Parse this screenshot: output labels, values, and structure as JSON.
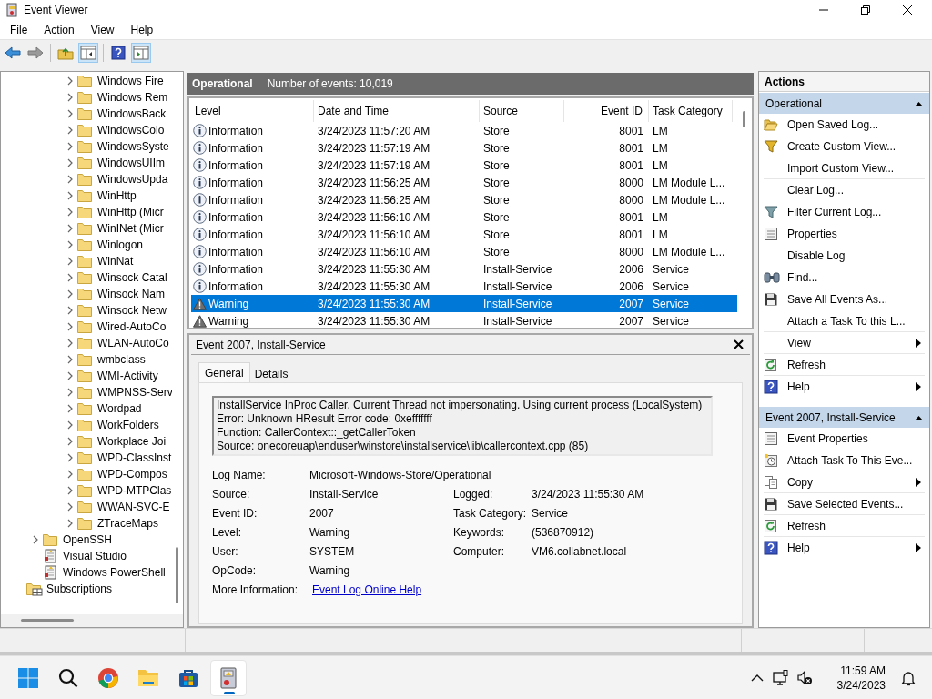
{
  "window": {
    "title": "Event Viewer"
  },
  "menu": [
    "File",
    "Action",
    "View",
    "Help"
  ],
  "toolbar": [
    {
      "kind": "back",
      "pressed": false
    },
    {
      "kind": "forward",
      "pressed": false
    },
    {
      "kind": "separator"
    },
    {
      "kind": "up",
      "pressed": false
    },
    {
      "kind": "tree-pane",
      "pressed": true
    },
    {
      "kind": "separator"
    },
    {
      "kind": "help",
      "pressed": false
    },
    {
      "kind": "action-pane",
      "pressed": true
    }
  ],
  "tree": [
    {
      "children": [
        {
          "children": [
            {
              "label": "Windows Fire",
              "kind": "folder",
              "expanded": false
            },
            {
              "label": "Windows Rem",
              "kind": "folder",
              "expanded": false
            },
            {
              "label": "WindowsBack",
              "kind": "folder",
              "expanded": false
            },
            {
              "label": "WindowsColo",
              "kind": "folder",
              "expanded": false
            },
            {
              "label": "WindowsSyste",
              "kind": "folder",
              "expanded": false
            },
            {
              "label": "WindowsUIIm",
              "kind": "folder",
              "expanded": false
            },
            {
              "label": "WindowsUpda",
              "kind": "folder",
              "expanded": false
            },
            {
              "label": "WinHttp",
              "kind": "folder",
              "expanded": false
            },
            {
              "label": "WinHttp (Micr",
              "kind": "folder",
              "expanded": false
            },
            {
              "label": "WinINet (Micr",
              "kind": "folder",
              "expanded": false
            },
            {
              "label": "Winlogon",
              "kind": "folder",
              "expanded": false
            },
            {
              "label": "WinNat",
              "kind": "folder",
              "expanded": false
            },
            {
              "label": "Winsock Catal",
              "kind": "folder",
              "expanded": false
            },
            {
              "label": "Winsock Nam",
              "kind": "folder",
              "expanded": false
            },
            {
              "label": "Winsock Netw",
              "kind": "folder",
              "expanded": false
            },
            {
              "label": "Wired-AutoCo",
              "kind": "folder",
              "expanded": false
            },
            {
              "label": "WLAN-AutoCo",
              "kind": "folder",
              "expanded": false
            },
            {
              "label": "wmbclass",
              "kind": "folder",
              "expanded": false
            },
            {
              "label": "WMI-Activity",
              "kind": "folder",
              "expanded": false
            },
            {
              "label": "WMPNSS-Serv",
              "kind": "folder",
              "expanded": false
            },
            {
              "label": "Wordpad",
              "kind": "folder",
              "expanded": false
            },
            {
              "label": "WorkFolders",
              "kind": "folder",
              "expanded": false
            },
            {
              "label": "Workplace Joi",
              "kind": "folder",
              "expanded": false
            },
            {
              "label": "WPD-ClassInst",
              "kind": "folder",
              "expanded": false
            },
            {
              "label": "WPD-Compos",
              "kind": "folder",
              "expanded": false
            },
            {
              "label": "WPD-MTPClas",
              "kind": "folder",
              "expanded": false
            },
            {
              "label": "WWAN-SVC-E",
              "kind": "folder",
              "expanded": false
            },
            {
              "label": "ZTraceMaps",
              "kind": "folder",
              "expanded": false
            }
          ]
        },
        {
          "label": "OpenSSH",
          "kind": "folder",
          "expanded": false
        },
        {
          "label": "Visual Studio",
          "kind": "log"
        },
        {
          "label": "Windows PowerShell",
          "kind": "log"
        }
      ]
    },
    {
      "label": "Subscriptions",
      "kind": "subscriptions"
    }
  ],
  "log_header": {
    "title": "Operational",
    "count": "Number of events: 10,019"
  },
  "events": {
    "columns": [
      "Level",
      "Date and Time",
      "Source",
      "Event ID",
      "Task Category"
    ],
    "rows": [
      {
        "kind": "information",
        "level": "Information",
        "date": "3/24/2023 11:57:20 AM",
        "source": "Store",
        "event_id": "8001",
        "task_category": "LM",
        "selected": false
      },
      {
        "kind": "information",
        "level": "Information",
        "date": "3/24/2023 11:57:19 AM",
        "source": "Store",
        "event_id": "8001",
        "task_category": "LM",
        "selected": false
      },
      {
        "kind": "information",
        "level": "Information",
        "date": "3/24/2023 11:57:19 AM",
        "source": "Store",
        "event_id": "8001",
        "task_category": "LM",
        "selected": false
      },
      {
        "kind": "information",
        "level": "Information",
        "date": "3/24/2023 11:56:25 AM",
        "source": "Store",
        "event_id": "8000",
        "task_category": "LM Module L...",
        "selected": false
      },
      {
        "kind": "information",
        "level": "Information",
        "date": "3/24/2023 11:56:25 AM",
        "source": "Store",
        "event_id": "8000",
        "task_category": "LM Module L...",
        "selected": false
      },
      {
        "kind": "information",
        "level": "Information",
        "date": "3/24/2023 11:56:10 AM",
        "source": "Store",
        "event_id": "8001",
        "task_category": "LM",
        "selected": false
      },
      {
        "kind": "information",
        "level": "Information",
        "date": "3/24/2023 11:56:10 AM",
        "source": "Store",
        "event_id": "8001",
        "task_category": "LM",
        "selected": false
      },
      {
        "kind": "information",
        "level": "Information",
        "date": "3/24/2023 11:56:10 AM",
        "source": "Store",
        "event_id": "8000",
        "task_category": "LM Module L...",
        "selected": false
      },
      {
        "kind": "information",
        "level": "Information",
        "date": "3/24/2023 11:55:30 AM",
        "source": "Install-Service",
        "event_id": "2006",
        "task_category": "Service",
        "selected": false
      },
      {
        "kind": "information",
        "level": "Information",
        "date": "3/24/2023 11:55:30 AM",
        "source": "Install-Service",
        "event_id": "2006",
        "task_category": "Service",
        "selected": false
      },
      {
        "kind": "warning",
        "level": "Warning",
        "date": "3/24/2023 11:55:30 AM",
        "source": "Install-Service",
        "event_id": "2007",
        "task_category": "Service",
        "selected": true
      },
      {
        "kind": "warning",
        "level": "Warning",
        "date": "3/24/2023 11:55:30 AM",
        "source": "Install-Service",
        "event_id": "2007",
        "task_category": "Service",
        "selected": false
      }
    ]
  },
  "detail": {
    "title": "Event 2007, Install-Service",
    "tabs": [
      {
        "label": "General",
        "selected": true
      },
      {
        "label": "Details",
        "selected": false
      }
    ],
    "description": [
      "InstallService InProc Caller. Current Thread not impersonating. Using current process (LocalSystem)",
      "Error: Unknown HResult Error code: 0xefffffff",
      "Function: CallerContext::_getCallerToken",
      "Source: onecoreuap\\enduser\\winstore\\installservice\\lib\\callercontext.cpp (85)"
    ],
    "properties": [
      [
        {
          "label": "Log Name:",
          "value": "Microsoft-Windows-Store/Operational"
        }
      ],
      [
        {
          "label": "Source:",
          "value": "Install-Service"
        },
        {
          "label": "Logged:",
          "value": "3/24/2023 11:55:30 AM"
        }
      ],
      [
        {
          "label": "Event ID:",
          "value": "2007"
        },
        {
          "label": "Task Category:",
          "value": "Service"
        }
      ],
      [
        {
          "label": "Level:",
          "value": "Warning"
        },
        {
          "label": "Keywords:",
          "value": "(536870912)"
        }
      ],
      [
        {
          "label": "User:",
          "value": "SYSTEM"
        },
        {
          "label": "Computer:",
          "value": "VM6.collabnet.local"
        }
      ],
      [
        {
          "label": "OpCode:",
          "value": "Warning"
        }
      ]
    ],
    "more_info": {
      "label": "More Information:",
      "link": "Event Log Online Help"
    }
  },
  "actions": {
    "title": "Actions",
    "sections": [
      {
        "title": "Operational",
        "expanded": true,
        "items": [
          {
            "label": "Open Saved Log...",
            "kind": "open-folder",
            "submenu": false,
            "divider_after": false
          },
          {
            "label": "Create Custom View...",
            "kind": "funnel-new",
            "submenu": false,
            "divider_after": false
          },
          {
            "label": "Import Custom View...",
            "kind": "none",
            "submenu": false,
            "divider_after": true
          },
          {
            "label": "Clear Log...",
            "kind": "none",
            "submenu": false,
            "divider_after": false
          },
          {
            "label": "Filter Current Log...",
            "kind": "funnel",
            "submenu": false,
            "divider_after": false
          },
          {
            "label": "Properties",
            "kind": "sheet",
            "submenu": false,
            "divider_after": false
          },
          {
            "label": "Disable Log",
            "kind": "none",
            "submenu": false,
            "divider_after": false
          },
          {
            "label": "Find...",
            "kind": "binoculars",
            "submenu": false,
            "divider_after": false
          },
          {
            "label": "Save All Events As...",
            "kind": "floppy",
            "submenu": false,
            "divider_after": false
          },
          {
            "label": "Attach a Task To this L...",
            "kind": "none",
            "submenu": false,
            "divider_after": true
          },
          {
            "label": "View",
            "kind": "none",
            "submenu": true,
            "divider_after": true
          },
          {
            "label": "Refresh",
            "kind": "refresh",
            "submenu": false,
            "divider_after": true
          },
          {
            "label": "Help",
            "kind": "help",
            "submenu": true,
            "divider_after": false
          }
        ]
      },
      {
        "title": "Event 2007, Install-Service",
        "expanded": true,
        "items": [
          {
            "label": "Event Properties",
            "kind": "sheet",
            "submenu": false,
            "divider_after": false
          },
          {
            "label": "Attach Task To This Eve...",
            "kind": "task",
            "submenu": false,
            "divider_after": false
          },
          {
            "label": "Copy",
            "kind": "copy",
            "submenu": true,
            "divider_after": true
          },
          {
            "label": "Save Selected Events...",
            "kind": "floppy",
            "submenu": false,
            "divider_after": true
          },
          {
            "label": "Refresh",
            "kind": "refresh",
            "submenu": false,
            "divider_after": true
          },
          {
            "label": "Help",
            "kind": "help",
            "submenu": true,
            "divider_after": false
          }
        ]
      }
    ]
  },
  "taskbar": {
    "apps": [
      {
        "kind": "start",
        "active": false
      },
      {
        "kind": "search",
        "active": false
      },
      {
        "kind": "browser",
        "active": false
      },
      {
        "kind": "files",
        "active": false
      },
      {
        "kind": "store",
        "active": false
      },
      {
        "kind": "event-viewer",
        "active": true
      }
    ],
    "time": "11:59 AM",
    "date": "3/24/2023"
  }
}
